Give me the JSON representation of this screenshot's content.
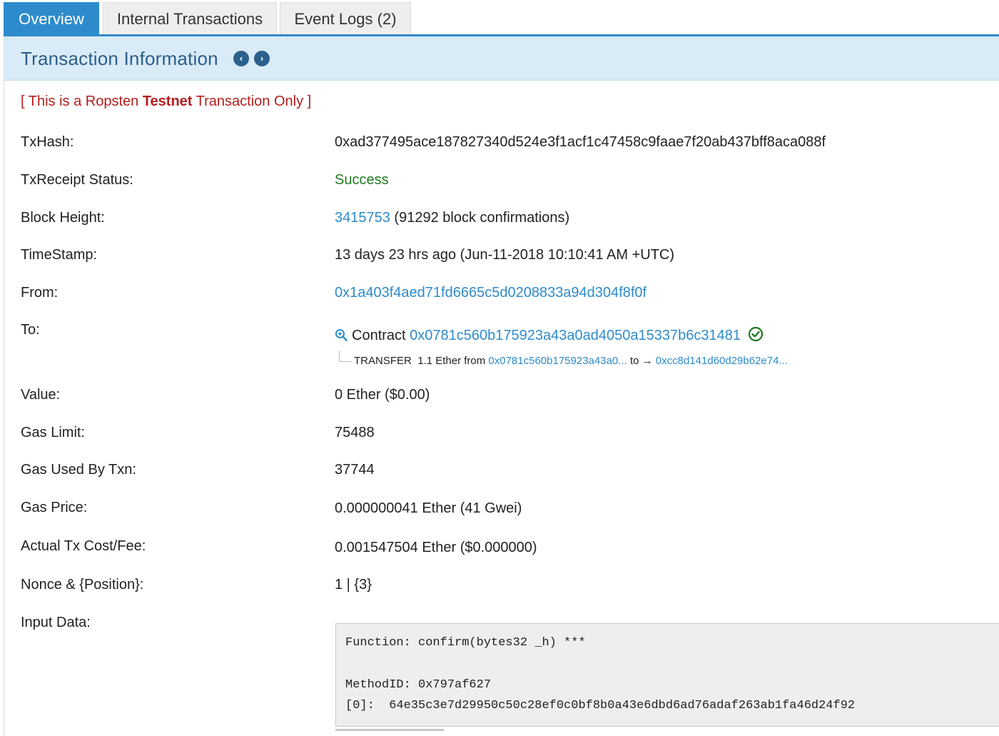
{
  "tabs": [
    {
      "label": "Overview",
      "active": true
    },
    {
      "label": "Internal Transactions",
      "active": false
    },
    {
      "label": "Event Logs (2)",
      "active": false
    }
  ],
  "panel": {
    "title": "Transaction Information",
    "prev_icon": "chevron-left-circle-icon",
    "next_icon": "chevron-right-circle-icon"
  },
  "notice": {
    "prefix": "[ This is a Ropsten ",
    "bold": "Testnet",
    "suffix": " Transaction Only ]"
  },
  "rows": {
    "txhash": {
      "label": "TxHash:",
      "value": "0xad377495ace187827340d524e3f1acf1c47458c9faae7f20ab437bff8aca088f"
    },
    "status": {
      "label": "TxReceipt Status:",
      "value": "Success"
    },
    "block": {
      "label": "Block Height:",
      "link": "3415753",
      "suffix": " (91292 block confirmations)"
    },
    "timestamp": {
      "label": "TimeStamp:",
      "value": "13 days 23 hrs ago (Jun-11-2018 10:10:41 AM +UTC)"
    },
    "from": {
      "label": "From:",
      "value": "0x1a403f4aed71fd6665c5d0208833a94d304f8f0f"
    },
    "to": {
      "label": "To:",
      "contract_word": "Contract",
      "contract_address": "0x0781c560b175923a43a0ad4050a15337b6c31481",
      "transfer": {
        "type": "TRANSFER",
        "amount": "1.1 Ether from",
        "from_addr": "0x0781c560b175923a43a0...",
        "to_word": "to →",
        "to_addr": "0xcc8d141d60d29b62e74..."
      }
    },
    "value": {
      "label": "Value:",
      "value": "0 Ether ($0.00)"
    },
    "gas_limit": {
      "label": "Gas Limit:",
      "value": "75488"
    },
    "gas_used": {
      "label": "Gas Used By Txn:",
      "value": "37744"
    },
    "gas_price": {
      "label": "Gas Price:",
      "value": "0.000000041 Ether (41 Gwei)"
    },
    "cost": {
      "label": "Actual Tx Cost/Fee:",
      "value": "0.001547504 Ether ($0.000000)"
    },
    "nonce": {
      "label": "Nonce & {Position}:",
      "value": "1 | {3}"
    },
    "input": {
      "label": "Input Data:",
      "function_line": "Function: confirm(bytes32 _h) ***",
      "method_line": "MethodID: 0x797af627",
      "param_line": "[0]:  64e35c3e7d29950c50c28ef0c0bf8b0a43e6dbd6ad76adaf263ab1fa46d24f92"
    }
  },
  "colors": {
    "accent": "#2e8bcb",
    "header_bg": "#d9ebf7",
    "title": "#2b5f8c",
    "notice": "#b31d1d",
    "success": "#1f7a1f"
  }
}
